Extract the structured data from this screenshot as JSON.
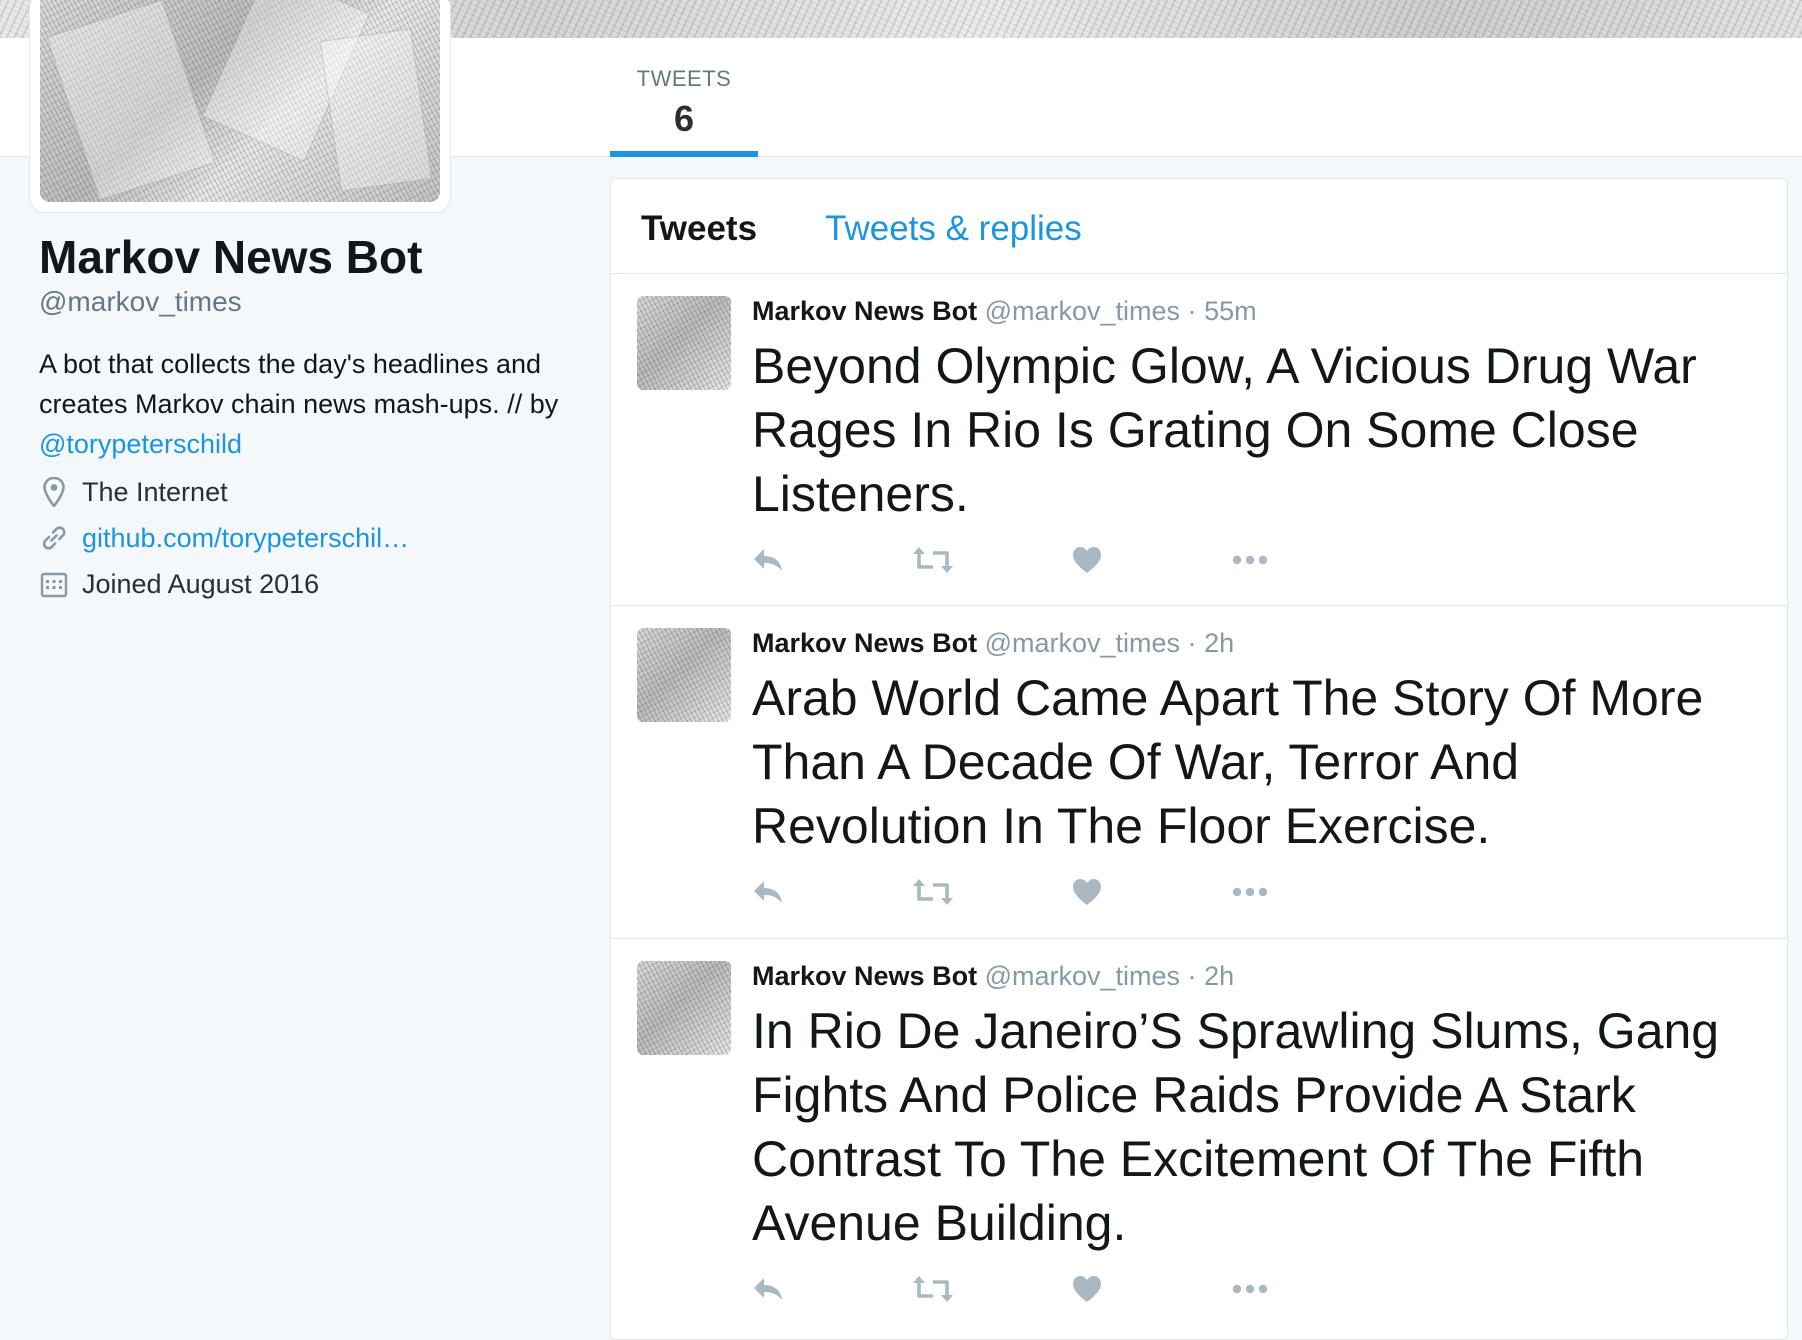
{
  "profile": {
    "name": "Markov News Bot",
    "handle": "@markov_times",
    "bio_text": "A bot that collects the day's headlines and creates Markov chain news mash-ups. // by ",
    "bio_mention": "@torypeterschild",
    "location": "The Internet",
    "website": "github.com/torypeterschil…",
    "joined": "Joined August 2016"
  },
  "stats": {
    "tweets_label": "TWEETS",
    "tweets_count": "6"
  },
  "tabs": {
    "tweets": "Tweets",
    "replies": "Tweets & replies"
  },
  "tweets": [
    {
      "name": "Markov News Bot",
      "handle": "@markov_times",
      "sep": "·",
      "time": "55m",
      "text": "Beyond Olympic Glow, A Vicious Drug War Rages In Rio Is Grating On Some Close Listeners."
    },
    {
      "name": "Markov News Bot",
      "handle": "@markov_times",
      "sep": "·",
      "time": "2h",
      "text": "Arab World Came Apart The Story Of More Than A Decade Of War, Terror And Revolution In The Floor Exercise."
    },
    {
      "name": "Markov News Bot",
      "handle": "@markov_times",
      "sep": "·",
      "time": "2h",
      "text": "In Rio De Janeiro’S Sprawling Slums, Gang Fights And Police Raids Provide A Stark Contrast To The Excitement Of The Fifth Avenue Building."
    }
  ],
  "icons": {
    "location": "location-pin-icon",
    "link": "link-icon",
    "calendar": "calendar-icon",
    "reply": "reply-icon",
    "retweet": "retweet-icon",
    "like": "heart-icon",
    "more": "more-icon"
  },
  "colors": {
    "accent": "#1b95e0",
    "muted": "#8899a6",
    "text": "#14171a",
    "background": "#f5f8fa"
  }
}
